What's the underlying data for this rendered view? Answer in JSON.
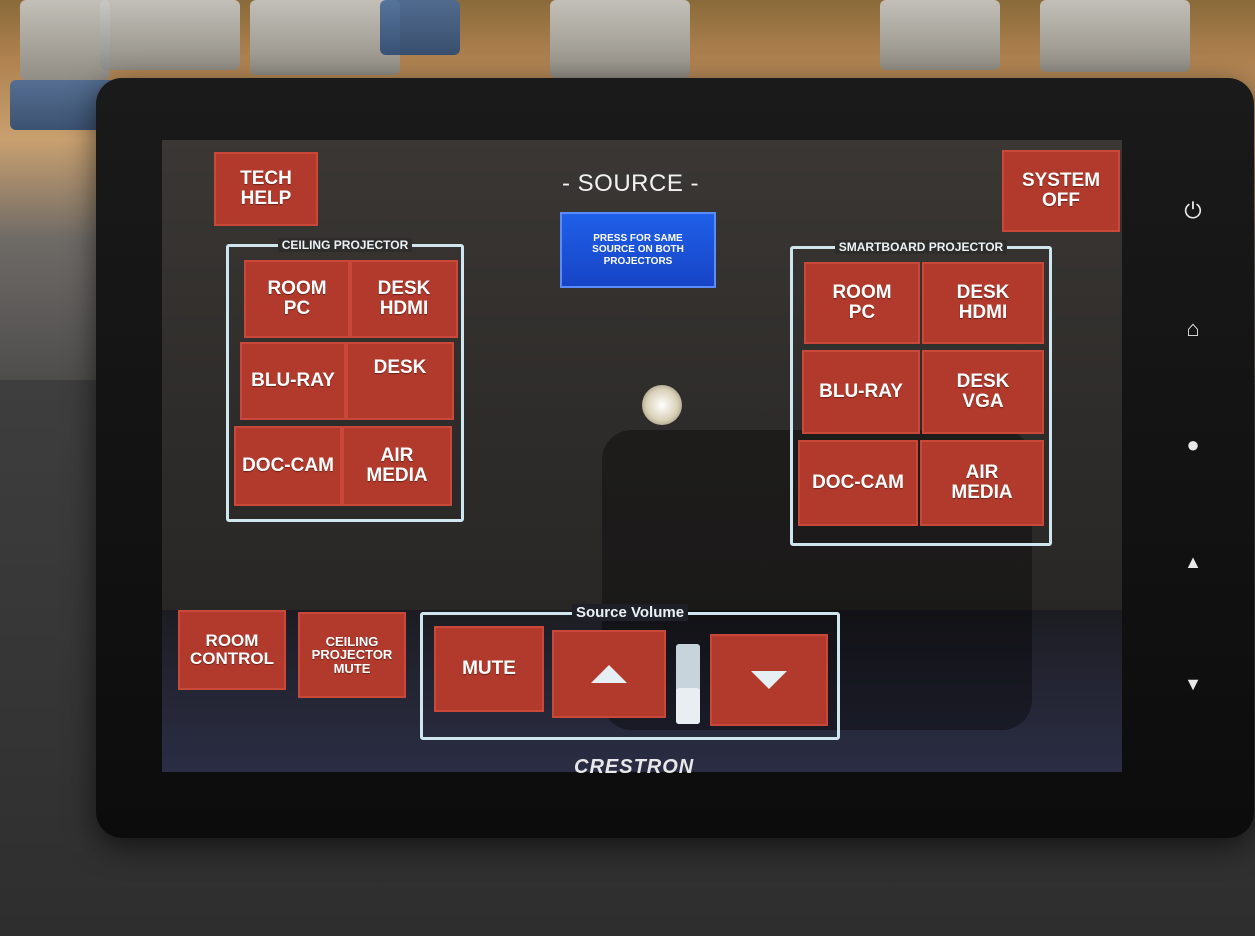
{
  "header": {
    "title": "- SOURCE -",
    "tech_help": "TECH\nHELP",
    "system_off": "SYSTEM\nOFF",
    "same_source": "PRESS FOR SAME\nSOURCE ON BOTH\nPROJECTORS"
  },
  "ceiling": {
    "label": "CEILING PROJECTOR",
    "room_pc": "ROOM\nPC",
    "desk_hdmi": "DESK\nHDMI",
    "blu_ray": "BLU-RAY",
    "desk": "DESK",
    "doc_cam": "DOC-CAM",
    "air_media": "AIR\nMEDIA"
  },
  "smartboard": {
    "label": "SMARTBOARD PROJECTOR",
    "room_pc": "ROOM\nPC",
    "desk_hdmi": "DESK\nHDMI",
    "blu_ray": "BLU-RAY",
    "desk_vga": "DESK\nVGA",
    "doc_cam": "DOC-CAM",
    "air_media": "AIR\nMEDIA"
  },
  "footer": {
    "room_control": "ROOM\nCONTROL",
    "ceiling_mute": "CEILING\nPROJECTOR\nMUTE",
    "volume_label": "Source Volume",
    "mute": "MUTE",
    "volume_level": 0.45
  },
  "device": {
    "brand": "CRESTRON"
  },
  "side_buttons": [
    "power-icon",
    "home-icon",
    "light-bulb-icon",
    "triangle-up-icon",
    "triangle-down-icon"
  ],
  "colors": {
    "button_red": "#b23a2c",
    "button_blue": "#1f60e8",
    "frame_outline": "#cfe6ef"
  }
}
